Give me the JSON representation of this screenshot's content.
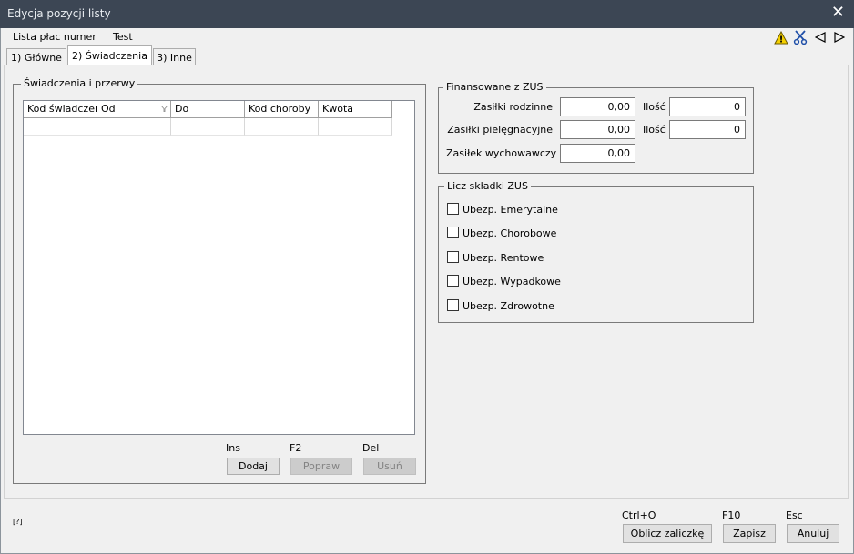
{
  "window": {
    "title": "Edycja pozycji listy",
    "close_glyph": "✕"
  },
  "header": {
    "list_label": "Lista płac numer",
    "list_value": "Test"
  },
  "toolbar": {
    "icons": [
      "warning-icon",
      "scissors-icon",
      "prev-icon",
      "next-icon"
    ],
    "warning_glyph": "!"
  },
  "tabs": [
    {
      "label": "1) Główne",
      "active": false
    },
    {
      "label": "2) Świadczenia",
      "active": true
    },
    {
      "label": "3) Inne",
      "active": false
    }
  ],
  "benefits": {
    "group_label": "Świadczenia i przerwy",
    "columns": [
      "Kod świadczer",
      "Od",
      "Do",
      "Kod choroby",
      "Kwota"
    ],
    "rows": [
      [
        "",
        "",
        "",
        "",
        ""
      ]
    ],
    "actions": [
      {
        "key": "Ins",
        "label": "Dodaj",
        "enabled": true
      },
      {
        "key": "F2",
        "label": "Popraw",
        "enabled": false
      },
      {
        "key": "Del",
        "label": "Usuń",
        "enabled": false
      }
    ]
  },
  "zus_funded": {
    "group_label": "Finansowane z ZUS",
    "rows": [
      {
        "label": "Zasiłki rodzinne",
        "value": "0,00",
        "qty_label": "Ilość",
        "qty": "0"
      },
      {
        "label": "Zasiłki pielęgnacyjne",
        "value": "0,00",
        "qty_label": "Ilość",
        "qty": "0"
      },
      {
        "label": "Zasiłek wychowawczy",
        "value": "0,00"
      }
    ]
  },
  "zus_contrib": {
    "group_label": "Licz składki ZUS",
    "items": [
      {
        "label": "Ubezp. Emerytalne",
        "checked": false
      },
      {
        "label": "Ubezp. Chorobowe",
        "checked": false
      },
      {
        "label": "Ubezp. Rentowe",
        "checked": false
      },
      {
        "label": "Ubezp. Wypadkowe",
        "checked": false
      },
      {
        "label": "Ubezp. Zdrowotne",
        "checked": false
      }
    ]
  },
  "footer": {
    "help": "[?]",
    "buttons": [
      {
        "key": "Ctrl+O",
        "label": "Oblicz zaliczkę"
      },
      {
        "key": "F10",
        "label": "Zapisz"
      },
      {
        "key": "Esc",
        "label": "Anuluj"
      }
    ]
  },
  "colors": {
    "titlebar": "#3c4654",
    "warning": "#f5d000",
    "tool_blue": "#1f4fa8"
  }
}
